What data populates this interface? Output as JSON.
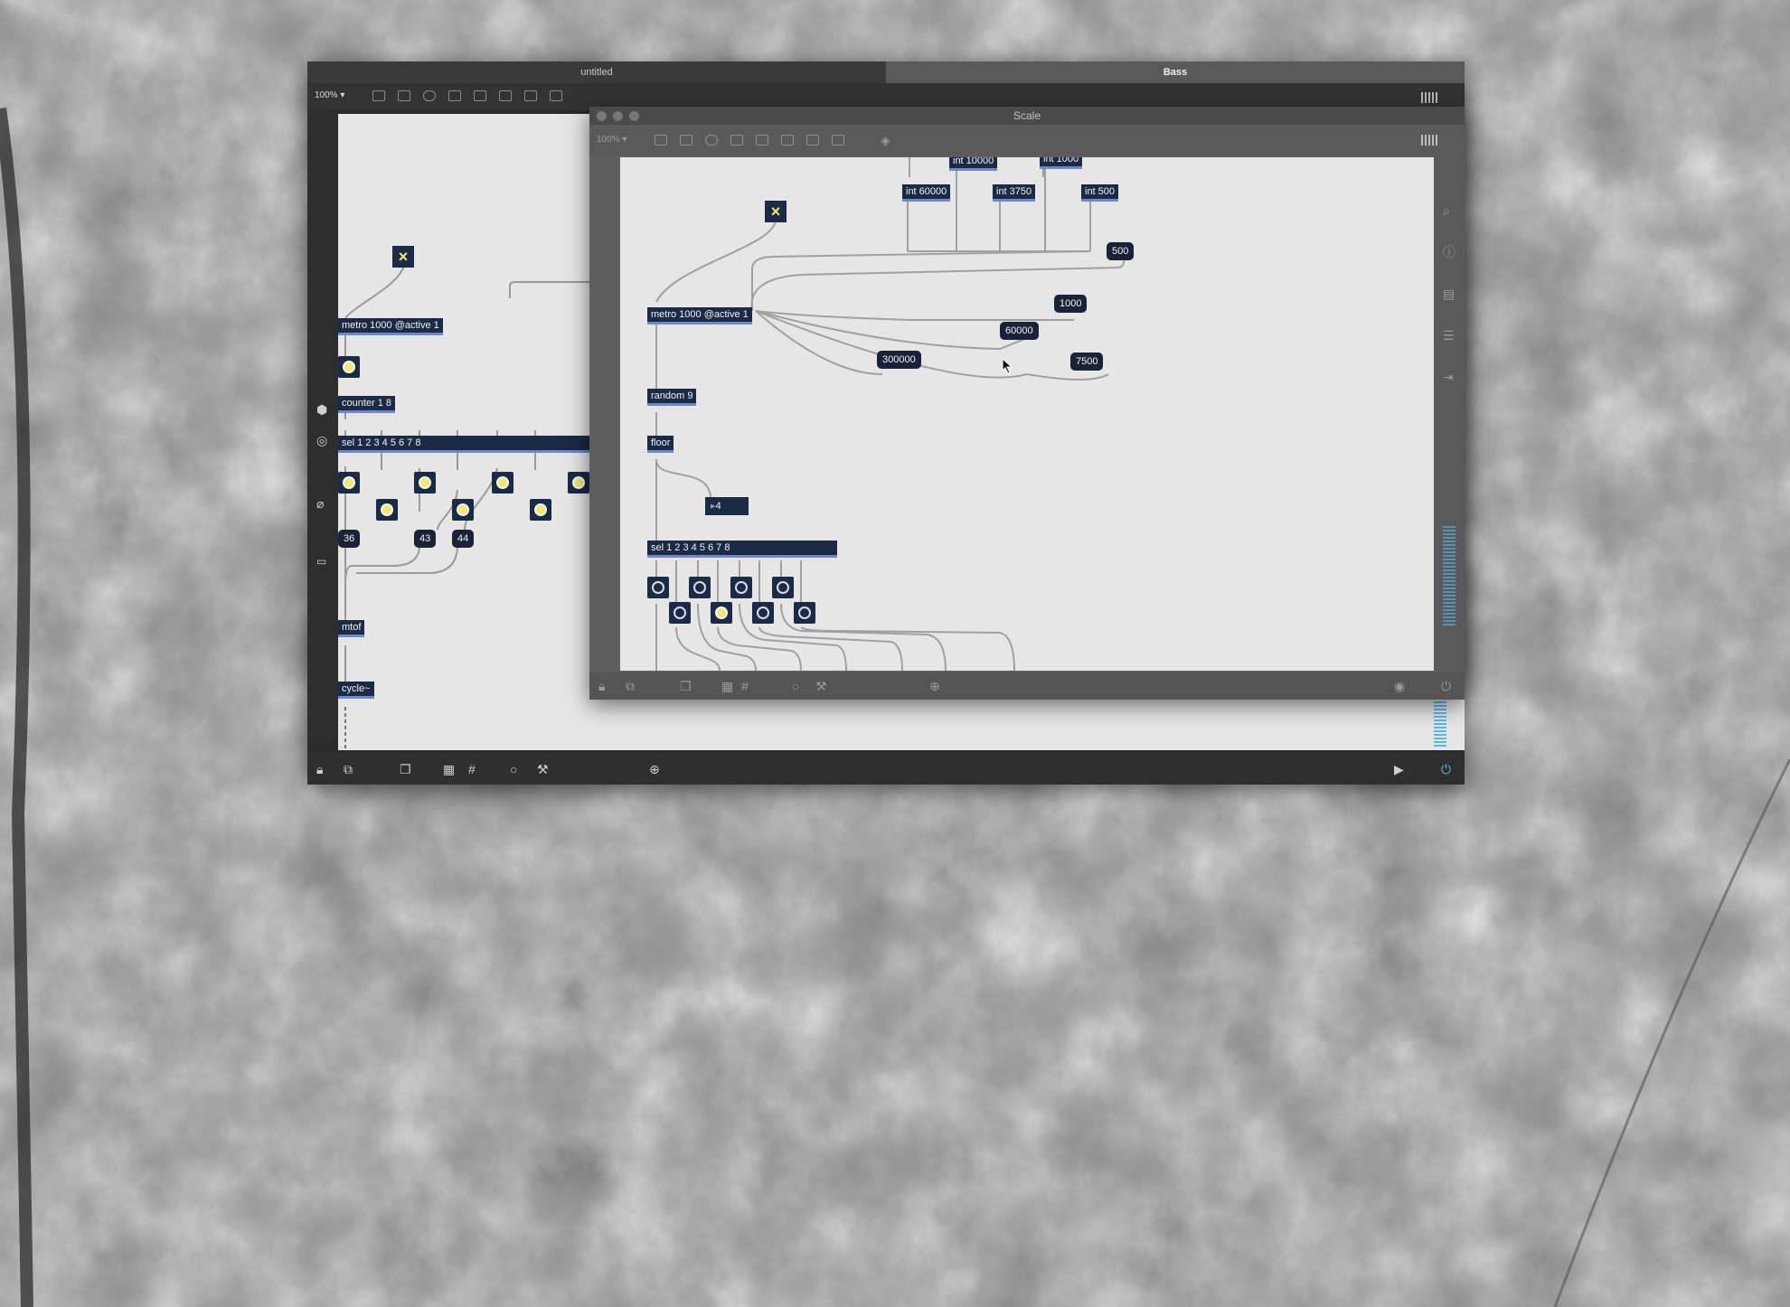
{
  "main_window": {
    "tabs": [
      {
        "label": "untitled",
        "active": false
      },
      {
        "label": "Bass",
        "active": true
      }
    ],
    "zoom_label": "100%",
    "zoom_arrow": "▾",
    "left_sidebar_icons": [
      "cube-icon",
      "target-icon",
      "paperclip-icon",
      "keyboard-icon"
    ],
    "objects": {
      "metro": "metro 1000 @active 1",
      "counter": "counter 1 8",
      "sel": "sel 1 2 3 4 5 6 7 8",
      "mtof": "mtof",
      "cycle": "cycle~"
    },
    "numbers": [
      "36",
      "43",
      "44"
    ],
    "bottom_icons": [
      "lock-icon",
      "presentation-icon",
      "windows-icon",
      "blocks-icon",
      "grid-icon",
      "circle-icon",
      "hammer-icon",
      "add-icon"
    ]
  },
  "scale_window": {
    "title": "Scale",
    "zoom_label": "100%",
    "zoom_arrow": "▾",
    "objects": {
      "int_10000": "int 10000",
      "int_1000": "int 1000",
      "int_60000": "int 60000",
      "int_3750": "int 3750",
      "int_500": "int 500",
      "metro": "metro 1000 @active 1",
      "random": "random 9",
      "floor": "floor",
      "sel": "sel 1 2 3 4 5 6 7 8"
    },
    "numbers": {
      "n500": "500",
      "n1000": "1000",
      "n60000": "60000",
      "n300000": "300000",
      "n7500": "7500",
      "float4": "4"
    },
    "right_sidebar_icons": [
      "search-icon",
      "info-icon",
      "panel-icon",
      "list-icon",
      "export-icon"
    ],
    "bottom_icons": [
      "lock-icon",
      "presentation-icon",
      "windows-icon",
      "blocks-icon",
      "grid-icon",
      "circle-icon",
      "hammer-icon",
      "add-icon"
    ]
  },
  "colors": {
    "object_bg": "#1b2a45",
    "inlet_accent": "#6f87c8",
    "bang_active": "#f3e774",
    "canvas": "#e6e6e6",
    "meter": "#5ab8e8"
  }
}
